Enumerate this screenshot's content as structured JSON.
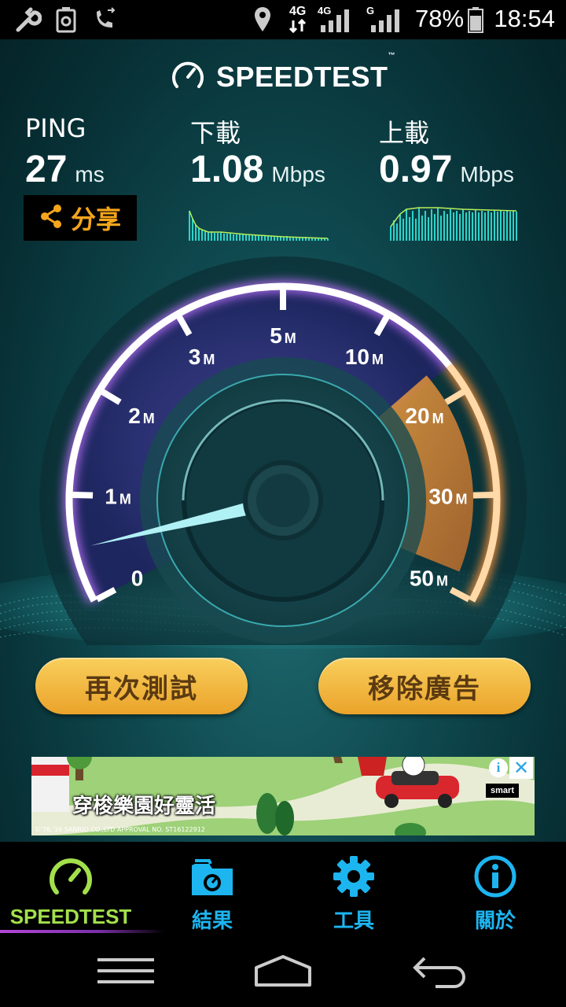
{
  "status_bar": {
    "time": "18:54",
    "battery_percent": "78%",
    "net1_label": "4G",
    "net2_label": "4G",
    "net3_label": "G",
    "icons": [
      "wrench-icon",
      "recycle-icon",
      "call-forward-icon",
      "location-icon",
      "data-arrows-icon",
      "signal-icon",
      "battery-icon"
    ]
  },
  "app": {
    "logo_text": "SPEEDTEST",
    "logo_tm": "™"
  },
  "stats": {
    "ping": {
      "title": "PING",
      "value": "27",
      "unit": "ms"
    },
    "download": {
      "title": "下載",
      "value": "1.08",
      "unit": "Mbps"
    },
    "upload": {
      "title": "上載",
      "value": "0.97",
      "unit": "Mbps"
    }
  },
  "share": {
    "label": "分享"
  },
  "gauge": {
    "labels": [
      {
        "num": "0",
        "unit": ""
      },
      {
        "num": "1",
        "unit": "M"
      },
      {
        "num": "2",
        "unit": "M"
      },
      {
        "num": "3",
        "unit": "M"
      },
      {
        "num": "5",
        "unit": "M"
      },
      {
        "num": "10",
        "unit": "M"
      },
      {
        "num": "20",
        "unit": "M"
      },
      {
        "num": "30",
        "unit": "M"
      },
      {
        "num": "50",
        "unit": "M"
      }
    ],
    "needle_value_mbps": 0.5,
    "colors": {
      "ring": "#ffffff",
      "glow": "#b06cf0",
      "hot": "#f7903a",
      "needle": "#aef6ff"
    }
  },
  "buttons": {
    "retest": "再次測試",
    "remove_ads": "移除廣告"
  },
  "ad": {
    "text": "穿梭樂園好靈活",
    "fineprint": "©'76,'16 SANRIO CO.,LTD APPROVAL NO. ST16122912",
    "brand": "smart",
    "info": "i",
    "close": "✕"
  },
  "tabs": [
    {
      "label": "SPEEDTEST",
      "icon": "speedometer-icon"
    },
    {
      "label": "結果",
      "icon": "results-folder-icon"
    },
    {
      "label": "工具",
      "icon": "gear-icon"
    },
    {
      "label": "關於",
      "icon": "info-icon"
    }
  ],
  "nav": {
    "icons": [
      "menu-icon",
      "home-icon",
      "back-icon"
    ]
  }
}
